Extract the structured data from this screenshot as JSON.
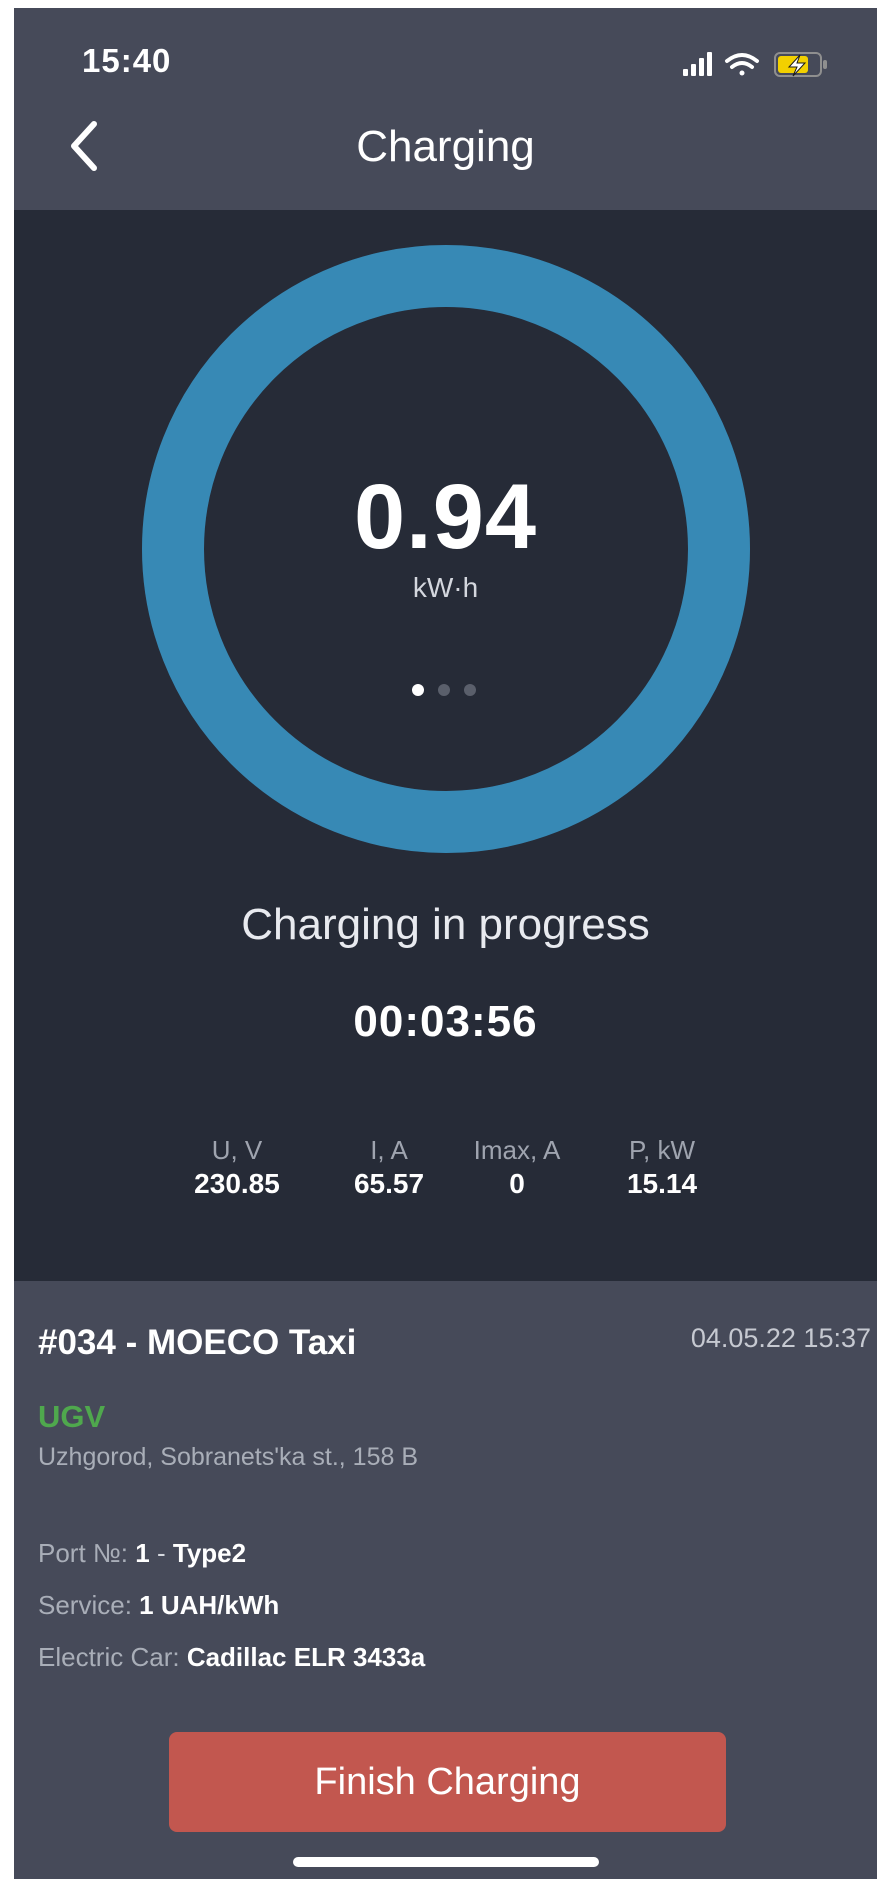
{
  "status_bar": {
    "time": "15:40",
    "icons": [
      "cellular-signal-icon",
      "wifi-icon",
      "battery-charging-icon"
    ]
  },
  "nav": {
    "title": "Charging",
    "back_icon": "chevron-left-icon"
  },
  "hero": {
    "energy_value": "0.94",
    "energy_unit": "kW·h",
    "progress_fraction": 1.0,
    "ring_color": "#3789b5",
    "pager": {
      "count": 3,
      "active_index": 0
    },
    "status_text": "Charging in progress",
    "timer": "00:03:56",
    "metrics": [
      {
        "label": "U,  V",
        "value": "230.85"
      },
      {
        "label": "I,  A",
        "value": "65.57"
      },
      {
        "label": "Imax,  A",
        "value": "0"
      },
      {
        "label": "P,  kW",
        "value": "15.14"
      }
    ]
  },
  "details": {
    "station_title": "#034 - MOECO Taxi",
    "date": "04.05.22 15:37",
    "operator": "UGV",
    "address": "Uzhgorod, Sobranets'ka st., 158 B",
    "port": {
      "label": "Port №:",
      "number": "1",
      "separator": "-",
      "type": "Type2"
    },
    "service": {
      "label": "Service:",
      "value": "1 UAH/kWh"
    },
    "car": {
      "label": "Electric Car:",
      "value": "Cadillac ELR 3433a"
    },
    "finish_button": "Finish Charging"
  },
  "colors": {
    "header_bg": "#464a59",
    "hero_bg": "#262b37",
    "operator_green": "#4fa84d",
    "finish_red": "#c2574f"
  }
}
